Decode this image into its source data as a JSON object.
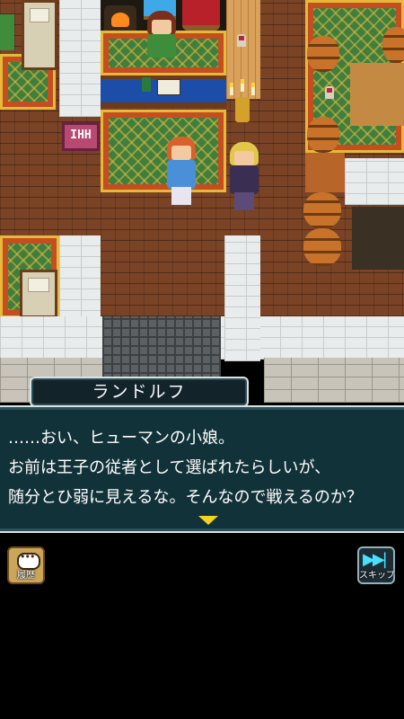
{
  "dialogue": {
    "speaker": "ランドルフ",
    "lines": [
      "……おい、ヒューマンの小娘。",
      "お前は王子の従者として選ばれたらしいが、",
      "随分とひ弱に見えるな。そんなので戦えるのか？"
    ]
  },
  "buttons": {
    "history": {
      "label": "履歴",
      "icon": "speech-bubble-icon"
    },
    "skip": {
      "label": "スキップ",
      "icon": "fast-forward-icon"
    }
  },
  "shop_sign": "IHH",
  "colors": {
    "dialog_bg": "#12323a",
    "frame": "#d8e4e4",
    "next_arrow": "#f4d21e",
    "skip_icon": "#47e0ff"
  }
}
